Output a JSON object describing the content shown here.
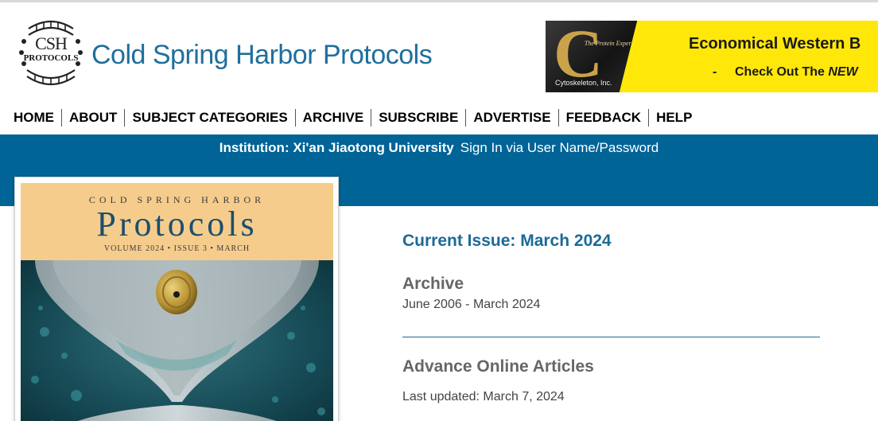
{
  "header": {
    "logo": {
      "emblem_text": "CSH",
      "emblem_subtext": "PROTOCOLS",
      "title": "Cold Spring Harbor Protocols"
    },
    "ad": {
      "company": "Cytoskeleton, Inc.",
      "tagline": "The Protein Experts",
      "headline": "Economical Western B",
      "dash": "-",
      "sub_prefix": "Check Out The ",
      "sub_emph": "NEW",
      "colors": {
        "background": "#ffe70a",
        "dark_panel": "#1a1a1a",
        "logo_gold": "#c9a24a"
      }
    }
  },
  "nav": {
    "items": [
      "HOME",
      "ABOUT",
      "SUBJECT CATEGORIES",
      "ARCHIVE",
      "SUBSCRIBE",
      "ADVERTISE",
      "FEEDBACK",
      "HELP"
    ]
  },
  "institution_bar": {
    "institution": "Institution: Xi'an Jiaotong University",
    "sign_in": "Sign In via User Name/Password",
    "color": "#006497"
  },
  "cover": {
    "publisher_line": "COLD SPRING HARBOR",
    "title": "Protocols",
    "volume_line": "VOLUME 2024 • ISSUE 3 • MARCH"
  },
  "main": {
    "current_issue": "Current Issue: March 2024",
    "archive": {
      "heading": "Archive",
      "range": "June 2006 - March 2024"
    },
    "advance": {
      "heading": "Advance Online Articles",
      "updated": "Last updated: March 7, 2024"
    },
    "accent_color": "#1b6a98"
  }
}
